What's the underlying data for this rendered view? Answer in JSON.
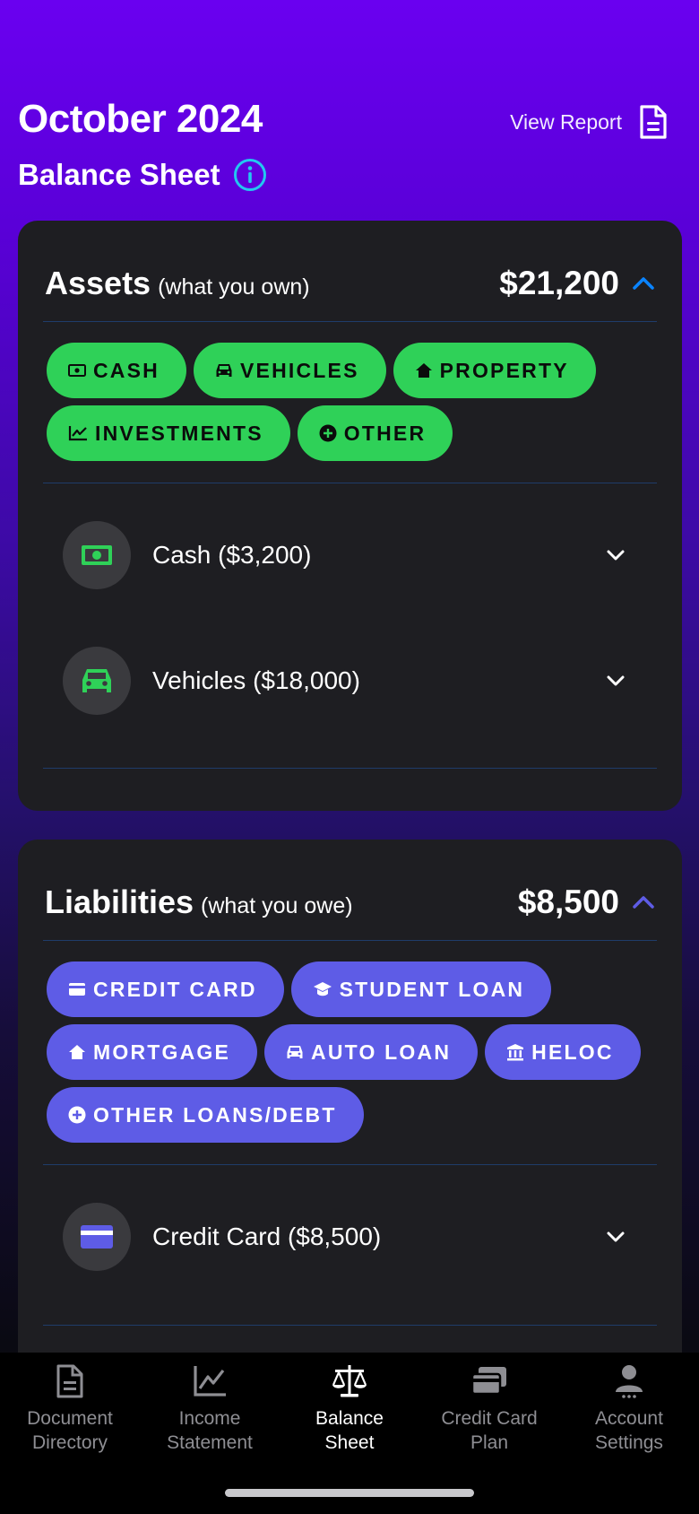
{
  "header": {
    "title": "October 2024",
    "subtitle": "Balance Sheet",
    "view_report": "View Report"
  },
  "assets": {
    "title": "Assets",
    "paren": "(what you own)",
    "total": "$21,200",
    "chips": [
      "CASH",
      "VEHICLES",
      "PROPERTY",
      "INVESTMENTS",
      "OTHER"
    ],
    "items": [
      {
        "label": "Cash ($3,200)"
      },
      {
        "label": "Vehicles ($18,000)"
      }
    ]
  },
  "liabilities": {
    "title": "Liabilities",
    "paren": "(what you owe)",
    "total": "$8,500",
    "chips": [
      "CREDIT CARD",
      "STUDENT LOAN",
      "MORTGAGE",
      "AUTO LOAN",
      "HELOC",
      "OTHER LOANS/DEBT"
    ],
    "items": [
      {
        "label": "Credit Card ($8,500)"
      }
    ]
  },
  "tabs": [
    {
      "line1": "Document",
      "line2": "Directory"
    },
    {
      "line1": "Income",
      "line2": "Statement"
    },
    {
      "line1": "Balance",
      "line2": "Sheet"
    },
    {
      "line1": "Credit Card",
      "line2": "Plan"
    },
    {
      "line1": "Account",
      "line2": "Settings"
    }
  ],
  "colors": {
    "asset_chip": "#2fd158",
    "liability_chip": "#5e5ce6",
    "accent_blue": "#0a84ff",
    "info_cyan": "#22c8f0"
  }
}
